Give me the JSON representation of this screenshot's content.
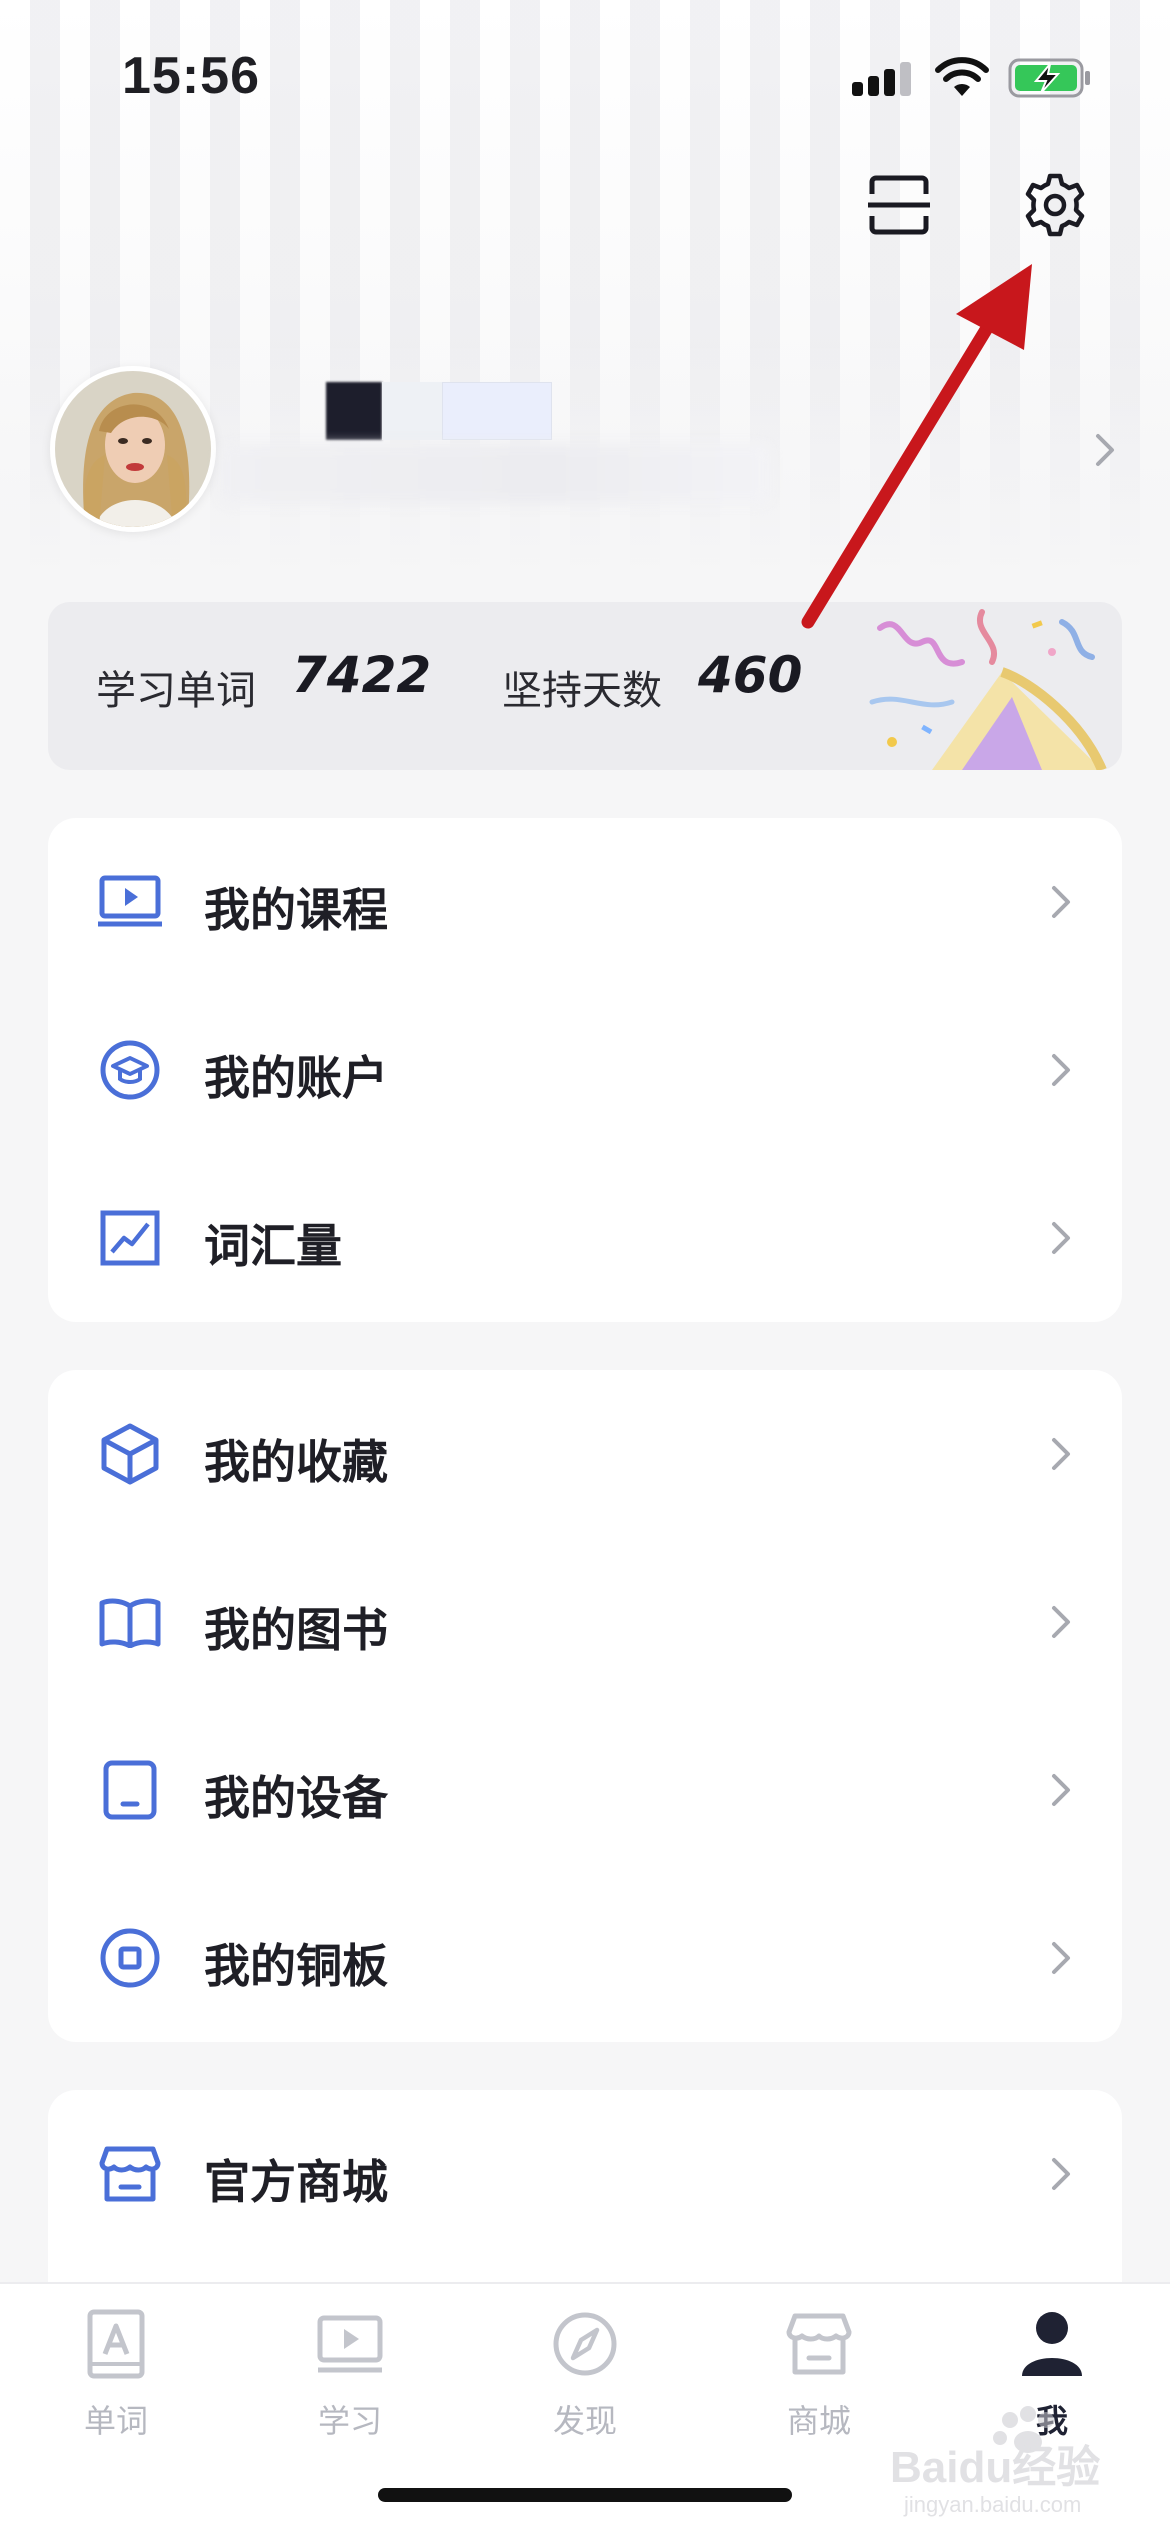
{
  "status_bar": {
    "time": "15:56"
  },
  "header": {
    "scan_icon": "scan-icon",
    "settings_icon": "gear-icon"
  },
  "profile": {
    "avatar_icon": "avatar"
  },
  "stats": {
    "words_label": "学习单词",
    "words_value": "7422",
    "days_label": "坚持天数",
    "days_value": "460"
  },
  "menu_group_1": {
    "items": [
      {
        "label": "我的课程",
        "icon": "course-play-icon"
      },
      {
        "label": "我的账户",
        "icon": "graduation-cap-icon"
      },
      {
        "label": "词汇量",
        "icon": "vocabulary-chart-icon"
      }
    ]
  },
  "menu_group_2": {
    "items": [
      {
        "label": "我的收藏",
        "icon": "box-icon"
      },
      {
        "label": "我的图书",
        "icon": "book-icon"
      },
      {
        "label": "我的设备",
        "icon": "device-icon"
      },
      {
        "label": "我的铜板",
        "icon": "coin-icon"
      }
    ]
  },
  "menu_group_3": {
    "items": [
      {
        "label": "官方商城",
        "icon": "shop-icon"
      }
    ]
  },
  "tab_bar": {
    "tabs": [
      {
        "label": "单词",
        "icon": "word-book-icon",
        "active": false
      },
      {
        "label": "学习",
        "icon": "play-screen-icon",
        "active": false
      },
      {
        "label": "发现",
        "icon": "compass-icon",
        "active": false
      },
      {
        "label": "商城",
        "icon": "shop-icon",
        "active": false
      },
      {
        "label": "我",
        "icon": "person-icon",
        "active": true
      }
    ]
  },
  "watermark": {
    "text": "Baidu经验",
    "subtext": "jingyan.baidu.com"
  },
  "colors": {
    "accent_blue": "#4a6fd8",
    "annotation_red": "#c8171c",
    "text_primary": "#1f1f26",
    "tab_inactive": "#b6b8c0"
  }
}
